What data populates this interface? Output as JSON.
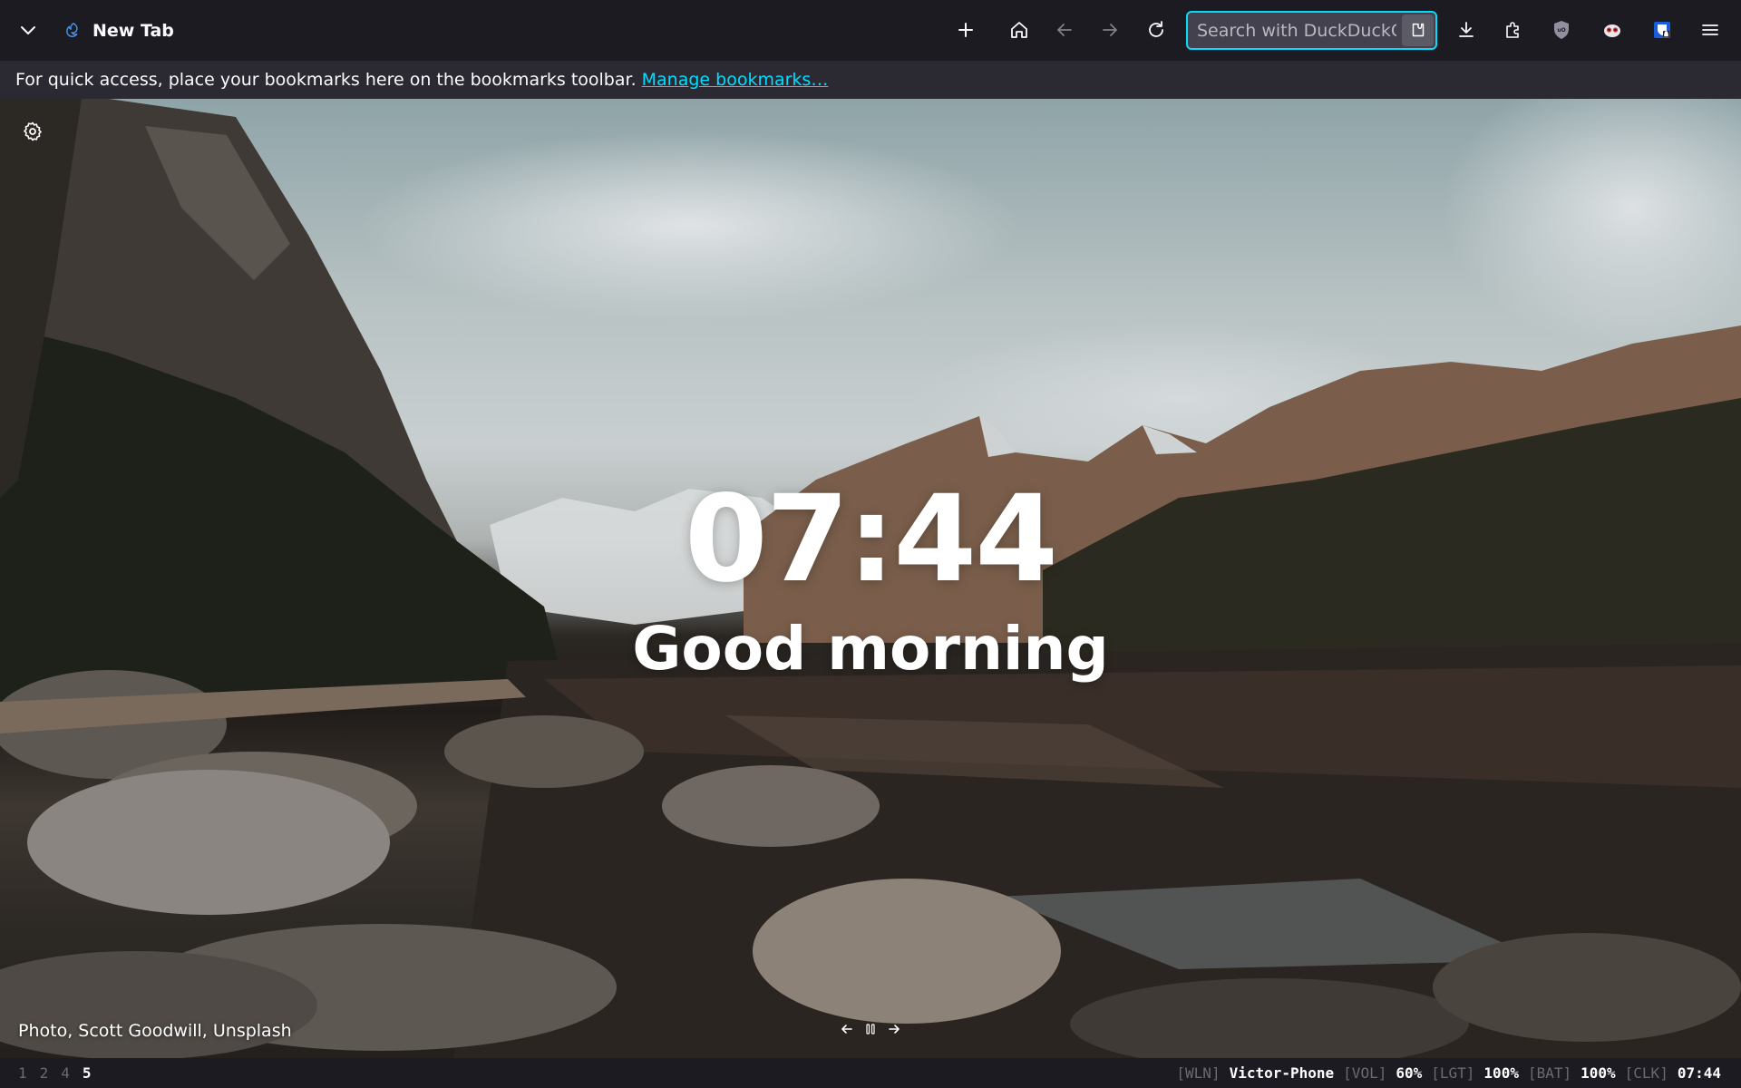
{
  "toolbar": {
    "tab_title": "New Tab",
    "search_placeholder": "Search with DuckDuckGo",
    "icons": [
      "chevron-down-icon",
      "firefox-icon",
      "plus-icon",
      "home-icon",
      "back-arrow-icon",
      "forward-arrow-icon",
      "reload-icon",
      "extension-icon",
      "download-icon",
      "puzzle-icon",
      "ublock-icon",
      "privacy-badger-icon",
      "bitwarden-icon",
      "hamburger-menu-icon"
    ]
  },
  "bookmarks_bar": {
    "message": "For quick access, place your bookmarks here on the bookmarks toolbar.",
    "link": "Manage bookmarks…"
  },
  "newtab": {
    "time": "07:44",
    "greeting": "Good morning",
    "credit": {
      "type": "Photo",
      "author": "Scott Goodwill",
      "source": "Unsplash"
    }
  },
  "statusbar": {
    "workspaces": [
      "1",
      "2",
      "4",
      "5"
    ],
    "active_workspace": "5",
    "items": [
      {
        "tag": "[WLN]",
        "value": "Victor-Phone"
      },
      {
        "tag": "[VOL]",
        "value": "60%"
      },
      {
        "tag": "[LGT]",
        "value": "100%"
      },
      {
        "tag": "[BAT]",
        "value": "100%"
      },
      {
        "tag": "[CLK]",
        "value": "07:44"
      }
    ]
  },
  "colors": {
    "toolbar_bg": "#1c1b22",
    "bookmarks_bg": "#2b2a33",
    "accent": "#00ddff"
  }
}
